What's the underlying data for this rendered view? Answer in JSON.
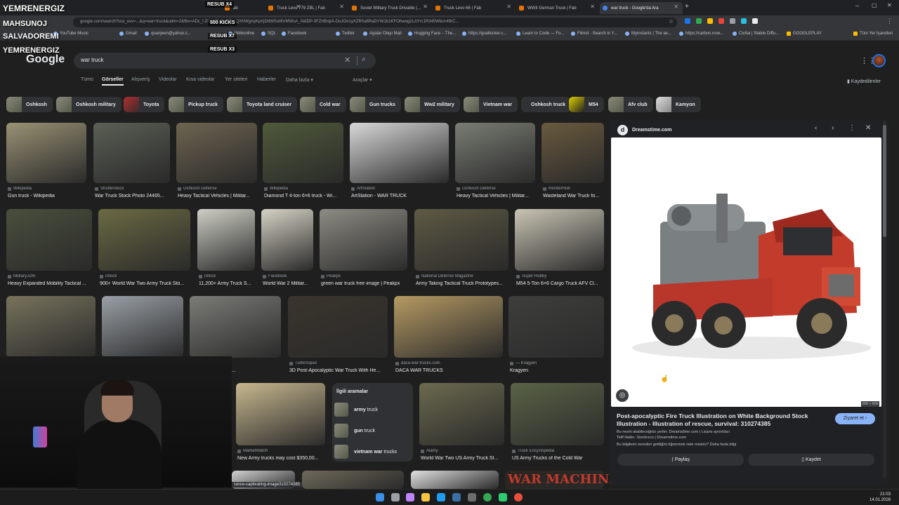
{
  "browser": {
    "tabs": [
      {
        "label": "ab"
      },
      {
        "label": "Truck Levo 779 ZBL | Fab"
      },
      {
        "label": "Soviet Military Truck Drivable (..."
      },
      {
        "label": "Truck Levo 66 | Fab"
      },
      {
        "label": "WWII German Truck | Fab"
      },
      {
        "label": "war truck - Google'da Ara"
      }
    ],
    "url": "google.com/search?sca_esv=...&q=war+truck&udm=2&fbs=ADc_l-ZKoNEV9sfFDmQXhWgAyKpXjDttW0sMiVMWsA_AtdDP-0FZnBrqIA-DoJOe1yXZR0a6RaDYW1b1KFOhwog2LAYrc1R345Wbcn49rC...",
    "bookmarks": [
      "YouTube Music",
      "Gmail",
      "quanjeen@yahoo.c...",
      "Webonline",
      "SQL",
      "Facebook",
      "Twitter",
      "Agalar Olayı Mail",
      "Hugging Face – The...",
      "https://goalkicker.c...",
      "Learn to Code — Fo...",
      "Filmot - Search in Y...",
      "Myinstants | The lar...",
      "https://carbon.now...",
      "Civitai | Stable Diffu...",
      "GOOGLEPLAY",
      "Tüm Yer İşaretleri"
    ]
  },
  "overlay": {
    "lines": [
      "YEMRENERGIZ",
      "MAHSUNOJ",
      "SALVADOREMI",
      "YEMRENERGIZ"
    ],
    "subs": [
      "RESUB X4",
      "500 KICKS",
      "RESUB X7",
      "RESUB X3"
    ]
  },
  "google": {
    "logo": "Google",
    "query": "war truck",
    "nav_tabs": [
      "Tümü",
      "Görseller",
      "Alışveriş",
      "Videolar",
      "Kısa videolar",
      "Yer siteleri",
      "Haberler",
      "Daha fazla ▾",
      "Araçlar ▾"
    ],
    "saved": "Kaydedilenler"
  },
  "chips": [
    "Oshkosh",
    "Oshkosh military",
    "Toyota",
    "Pickup truck",
    "Toyota land cruiser",
    "Cold war",
    "Gun trucks",
    "Ww2 military",
    "Vietnam war",
    "Oshkosh truck",
    "M54",
    "Afv club",
    "Kamyon"
  ],
  "results": [
    {
      "source": "Wikipedia",
      "title": "Gun truck - Wikipedia",
      "color": "#9a9274"
    },
    {
      "source": "Shutterstock",
      "title": "War Truck Stock Photo 24465...",
      "color": "#5b5f55"
    },
    {
      "source": "Oshkosh Defense",
      "title": "Heavy Tactical Vehicles | Militar...",
      "color": "#6e6450"
    },
    {
      "source": "Wikipedia",
      "title": "Diamond T 4-ton 6×6 truck - Wi...",
      "color": "#4f5a3a"
    },
    {
      "source": "ArtStation",
      "title": "ArtStation - WAR TRUCK",
      "color": "#d8d8d8"
    },
    {
      "source": "Oshkosh Defense",
      "title": "Heavy Tactical Vehicles | Militar...",
      "color": "#7a7d74"
    },
    {
      "source": "RenderHub",
      "title": "Wasteland War Truck fo...",
      "color": "#6a5a3e"
    },
    {
      "source": "Military.com",
      "title": "Heavy Expanded Mobility Tactical ...",
      "color": "#4a4f3c"
    },
    {
      "source": "iStock",
      "title": "900+ World War Two Army Truck Sto...",
      "color": "#6b6a43"
    },
    {
      "source": "iStock",
      "title": "11,200+ Army Truck S...",
      "color": "#cfcfc6"
    },
    {
      "source": "Facebook",
      "title": "World War 2 Militar...",
      "color": "#d6d2c4"
    },
    {
      "source": "Peakpx",
      "title": "green war truck free image | Peakpx",
      "color": "#8d8c84"
    },
    {
      "source": "National Defense Magazine",
      "title": "Army Taking Tactical Truck Prototypes...",
      "color": "#5e5a44"
    },
    {
      "source": "Super-Hobby",
      "title": "M54 5-Ton 6×6 Cargo Truck AFV Cl...",
      "color": "#c9c4b4"
    },
    {
      "source": "",
      "title": "",
      "color": "#77735c"
    },
    {
      "source": "",
      "title": "",
      "color": "#9aa0a6"
    },
    {
      "source": "",
      "title": "ashes Vintage U.S...",
      "color": "#7b7b77"
    },
    {
      "source": "TurboSquid",
      "title": "3D Post-Apocalyptic War Truck With He...",
      "color": "#3a352d"
    },
    {
      "source": "daca-war-trucks.com",
      "title": "DACA WAR TRUCKS",
      "color": "#b59a63"
    },
    {
      "source": "— Kragyen",
      "title": "Kragyen",
      "color": "#3e3f3d"
    },
    {
      "source": "MarketWatch",
      "title": "New Army trucks may cost $350,00...",
      "color": "#c8b88f"
    },
    {
      "source": "Alamy",
      "title": "World War Two US Army Truck St...",
      "color": "#6c6a4e"
    },
    {
      "source": "Truck Encyclopedia",
      "title": "US Army Trucks of the Cold War",
      "color": "#5a6346"
    },
    {
      "source": "",
      "title": "",
      "color": "#d2d2d2"
    },
    {
      "source": "",
      "title": "",
      "color": "#6f6a5a"
    },
    {
      "source": "",
      "title": "",
      "color": "#e0e0e0"
    },
    {
      "source": "",
      "title": "WAR MACHINE",
      "color": "#2a2520"
    }
  ],
  "bottom_caption": "rance-captivating-image310274385",
  "related": {
    "heading": "İlgili aramalar",
    "items": [
      {
        "pre": "",
        "bold": "army",
        "post": " truck"
      },
      {
        "pre": "",
        "bold": "gun",
        "post": " truck"
      },
      {
        "pre": "",
        "bold": "vietnam war",
        "post": " trucks"
      }
    ]
  },
  "preview": {
    "site": "Dreamstime.com",
    "resolution": "800 × 800",
    "title": "Post-apocalyptic Fire Truck Illustration on White Background Stock Illustration - Illustration of rescue, survival: 310274385",
    "visit": "Ziyaret et ›",
    "line1": "Bu resmi alabileceğiniz yerler: Dreamstime.com | Lisans ayrıntıları",
    "line2": "Telif Hakkı: Stockreco | Dreamstime.com",
    "line3": "Bu bilgilerin nereden geldiğini öğrenmek ister misiniz? Daha fazla bilgi",
    "share": "Paylaş",
    "save": "Kaydet"
  },
  "clock": {
    "time": "21:03",
    "date": "14.01.2026"
  },
  "colors": {
    "accent": "#8ab4f8",
    "bg": "#1f1f1f",
    "card": "#303134"
  }
}
